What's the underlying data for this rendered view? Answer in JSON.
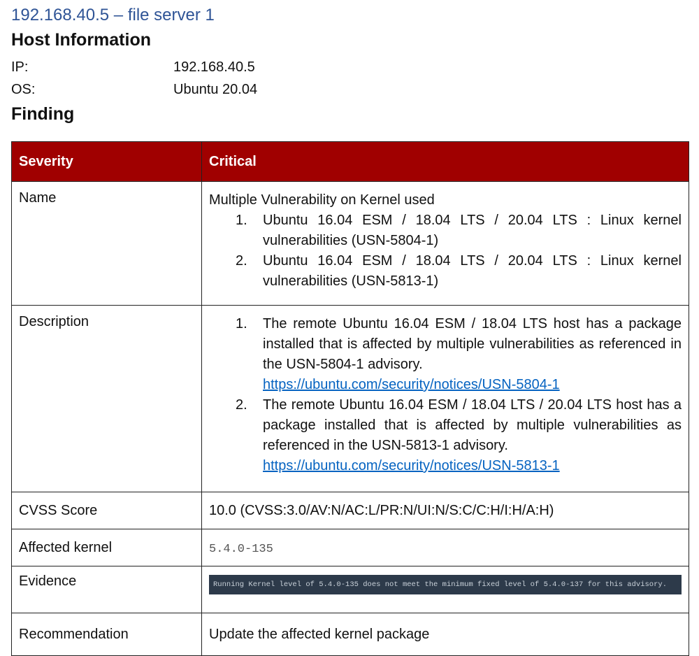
{
  "document": {
    "title": "192.168.40.5 – file server 1",
    "host_heading": "Host Information",
    "host": {
      "ip_label": "IP:",
      "ip_value": "192.168.40.5",
      "os_label": "OS:",
      "os_value": "Ubuntu 20.04"
    },
    "finding_heading": "Finding"
  },
  "table": {
    "header": {
      "label": "Severity",
      "value": "Critical"
    },
    "name": {
      "label": "Name",
      "intro": "Multiple Vulnerability on Kernel used",
      "items": [
        {
          "num": "1.",
          "text": "Ubuntu 16.04 ESM / 18.04 LTS / 20.04 LTS : Linux kernel vulnerabilities (USN-5804-1)"
        },
        {
          "num": "2.",
          "text": "Ubuntu 16.04 ESM / 18.04 LTS / 20.04 LTS : Linux kernel vulnerabilities (USN-5813-1)"
        }
      ]
    },
    "description": {
      "label": "Description",
      "items": [
        {
          "num": "1.",
          "text": "The remote Ubuntu 16.04 ESM / 18.04 LTS host has a package installed that is affected by multiple vulnerabilities as referenced in the USN-5804-1 advisory.",
          "link": "https://ubuntu.com/security/notices/USN-5804-1"
        },
        {
          "num": "2.",
          "text": "The remote Ubuntu 16.04 ESM / 18.04 LTS / 20.04 LTS host has a package installed that is affected by multiple vulnerabilities as referenced in the USN-5813-1 advisory.",
          "link": "https://ubuntu.com/security/notices/USN-5813-1"
        }
      ]
    },
    "cvss": {
      "label": "CVSS Score",
      "value": "10.0 (CVSS:3.0/AV:N/AC:L/PR:N/UI:N/S:C/C:H/I:H/A:H)"
    },
    "kernel": {
      "label": "Affected kernel",
      "value": "5.4.0-135"
    },
    "evidence": {
      "label": "Evidence",
      "value": "Running Kernel level of 5.4.0-135 does not meet the minimum fixed level of 5.4.0-137 for this advisory."
    },
    "recommendation": {
      "label": "Recommendation",
      "value": "Update the affected kernel package"
    }
  }
}
